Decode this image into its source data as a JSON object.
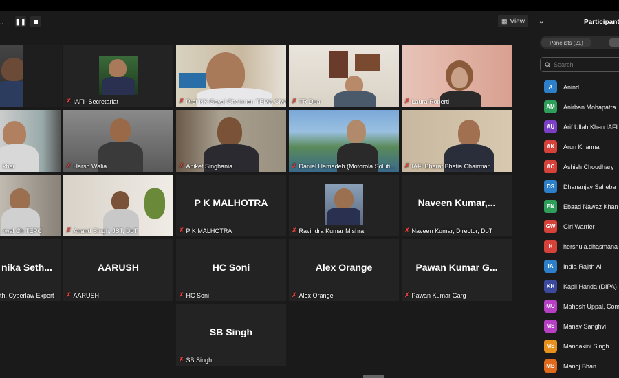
{
  "view_label": "View",
  "sidebar": {
    "title": "Participants",
    "tab_panelists": "Panelists (21)",
    "search_placeholder": "Search",
    "participants": [
      {
        "initials": "A",
        "name": "Anind",
        "color": "#2d7fc9"
      },
      {
        "initials": "AM",
        "name": "Anirban Mohapatra",
        "color": "#2e9e5b"
      },
      {
        "initials": "AU",
        "name": "Arif Ullah Khan IAFI",
        "color": "#7a3fc4"
      },
      {
        "initials": "AK",
        "name": "Arun Khanna",
        "color": "#d6413a"
      },
      {
        "initials": "AC",
        "name": "Ashish Choudhary",
        "color": "#d6413a"
      },
      {
        "initials": "DS",
        "name": "Dhananjay Saheba",
        "color": "#2d7fc9"
      },
      {
        "initials": "EN",
        "name": "Ebaad Nawaz Khan",
        "color": "#2e9e5b"
      },
      {
        "initials": "GW",
        "name": "Giri Warrier",
        "color": "#d6413a"
      },
      {
        "initials": "H",
        "name": "hershula.dhasmana",
        "color": "#d6413a"
      },
      {
        "initials": "IA",
        "name": "India-Rajith Ali",
        "color": "#2d7fc9"
      },
      {
        "initials": "KH",
        "name": "Kapil Handa (DIPA)",
        "color": "#3b4a9c"
      },
      {
        "initials": "MU",
        "name": "Mahesh Uppal, Com",
        "color": "#b63fc4"
      },
      {
        "initials": "MS",
        "name": "Manav Sanghvi",
        "color": "#b63fc4"
      },
      {
        "initials": "MS",
        "name": "Mandakini Singh",
        "color": "#e8901c"
      },
      {
        "initials": "MB",
        "name": "Manoj Bhan",
        "color": "#e06a1c"
      }
    ]
  },
  "tiles": [
    {
      "name": "",
      "big": "",
      "video": true,
      "active": true,
      "mic": false
    },
    {
      "name": "IAFI- Secretariat",
      "big": "",
      "video": true
    },
    {
      "name": "Prof NK Goyal Chairman TEMA CMAI",
      "big": "",
      "video": true
    },
    {
      "name": "TR Dua",
      "big": "",
      "video": true
    },
    {
      "name": "Laura Roberti",
      "big": "",
      "video": true
    },
    {
      "name": "khar",
      "big": "",
      "video": true,
      "mic": false
    },
    {
      "name": "Harsh Walia",
      "big": "",
      "video": true
    },
    {
      "name": "Aniket Singhania",
      "big": "",
      "video": true
    },
    {
      "name": "Daniel Hamadeh (Motorola Soluti...",
      "big": "",
      "video": true
    },
    {
      "name": "IAFI Bharat Bhatia Chairman",
      "big": "",
      "video": true
    },
    {
      "name": "rwal Ch TEPC",
      "big": "",
      "video": true,
      "mic": false
    },
    {
      "name": "Anand Singh, JST, DoT",
      "big": "",
      "video": true
    },
    {
      "name": "P K MALHOTRA",
      "big": "P K MALHOTRA",
      "video": false
    },
    {
      "name": "Ravindra Kumar Mishra",
      "big": "",
      "video": true
    },
    {
      "name": "Naveen Kumar, Director, DoT",
      "big": "Naveen Kumar,...",
      "video": false
    },
    {
      "name": "th, Cyberlaw Expert",
      "big": "nika Seth...",
      "video": false,
      "mic": false
    },
    {
      "name": "AARUSH",
      "big": "AARUSH",
      "video": false
    },
    {
      "name": "HC Soni",
      "big": "HC Soni",
      "video": false
    },
    {
      "name": "Alex Orange",
      "big": "Alex Orange",
      "video": false
    },
    {
      "name": "Pawan Kumar Garg",
      "big": "Pawan Kumar G...",
      "video": false
    },
    {
      "name": "SB Singh",
      "big": "SB Singh",
      "video": false
    }
  ]
}
